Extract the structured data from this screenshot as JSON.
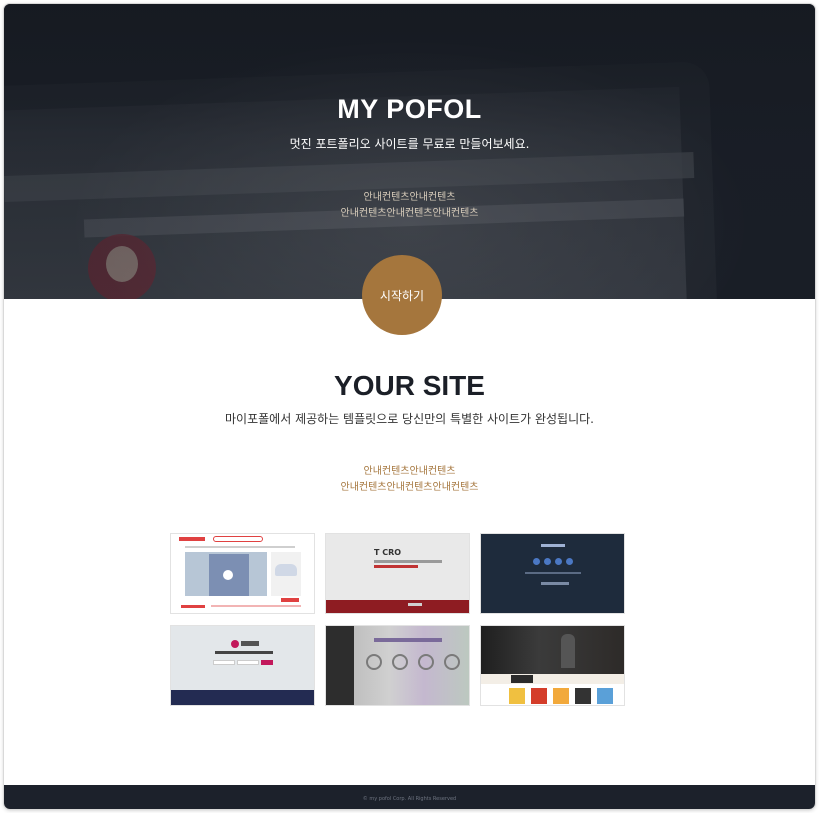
{
  "hero": {
    "title": "MY POFOL",
    "subtitle": "멋진 포트폴리오 사이트를 무료로 만들어보세요.",
    "info_line1": "안내컨텐츠안내컨텐츠",
    "info_line2": "안내컨텐츠안내컨텐츠안내컨텐츠",
    "start_button_label": "시작하기"
  },
  "your_site": {
    "title": "YOUR SITE",
    "subtitle": "마이포폴에서 제공하는 템플릿으로 당신만의 특별한 사이트가 완성됩니다.",
    "info_line1": "안내컨텐츠안내컨텐츠",
    "info_line2": "안내컨텐츠안내컨텐츠안내컨텐츠"
  },
  "thumbnails": [
    {
      "title": "",
      "thumb_label": "T CRO"
    },
    {
      "title": "",
      "thumb_label": "IP Software Defined Networking"
    }
  ],
  "footer": {
    "copyright": "© my pofol Corp. All Rights Reserved"
  },
  "colors": {
    "accent": "#a5763d",
    "dark": "#1c212b"
  }
}
